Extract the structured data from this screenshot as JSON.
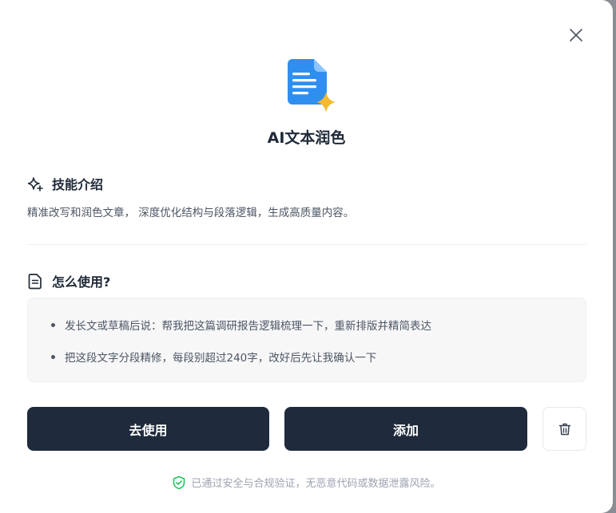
{
  "dialog": {
    "title": "AI文本润色",
    "close_icon": "close-icon",
    "app_icon": "document-sparkle-icon"
  },
  "skill": {
    "heading": "技能介绍",
    "icon": "sparkle-icon",
    "description": "精准改写和润色文章， 深度优化结构与段落逻辑，生成高质量内容。"
  },
  "usage": {
    "heading": "怎么使用?",
    "icon": "document-icon",
    "examples": [
      "发长文或草稿后说：帮我把这篇调研报告逻辑梳理一下，重新排版并精简表达",
      "把这段文字分段精修，每段别超过240字，改好后先让我确认一下"
    ]
  },
  "actions": {
    "use_label": "去使用",
    "add_label": "添加",
    "delete_icon": "trash-icon"
  },
  "footer": {
    "icon": "shield-check-icon",
    "text": "已通过安全与合规验证，无恶意代码或数据泄露风险。"
  },
  "colors": {
    "button_bg": "#1f2a3c",
    "icon_blue": "#2f8ff0",
    "sparkle": "#f5b82e",
    "shield_green": "#22c55e"
  }
}
